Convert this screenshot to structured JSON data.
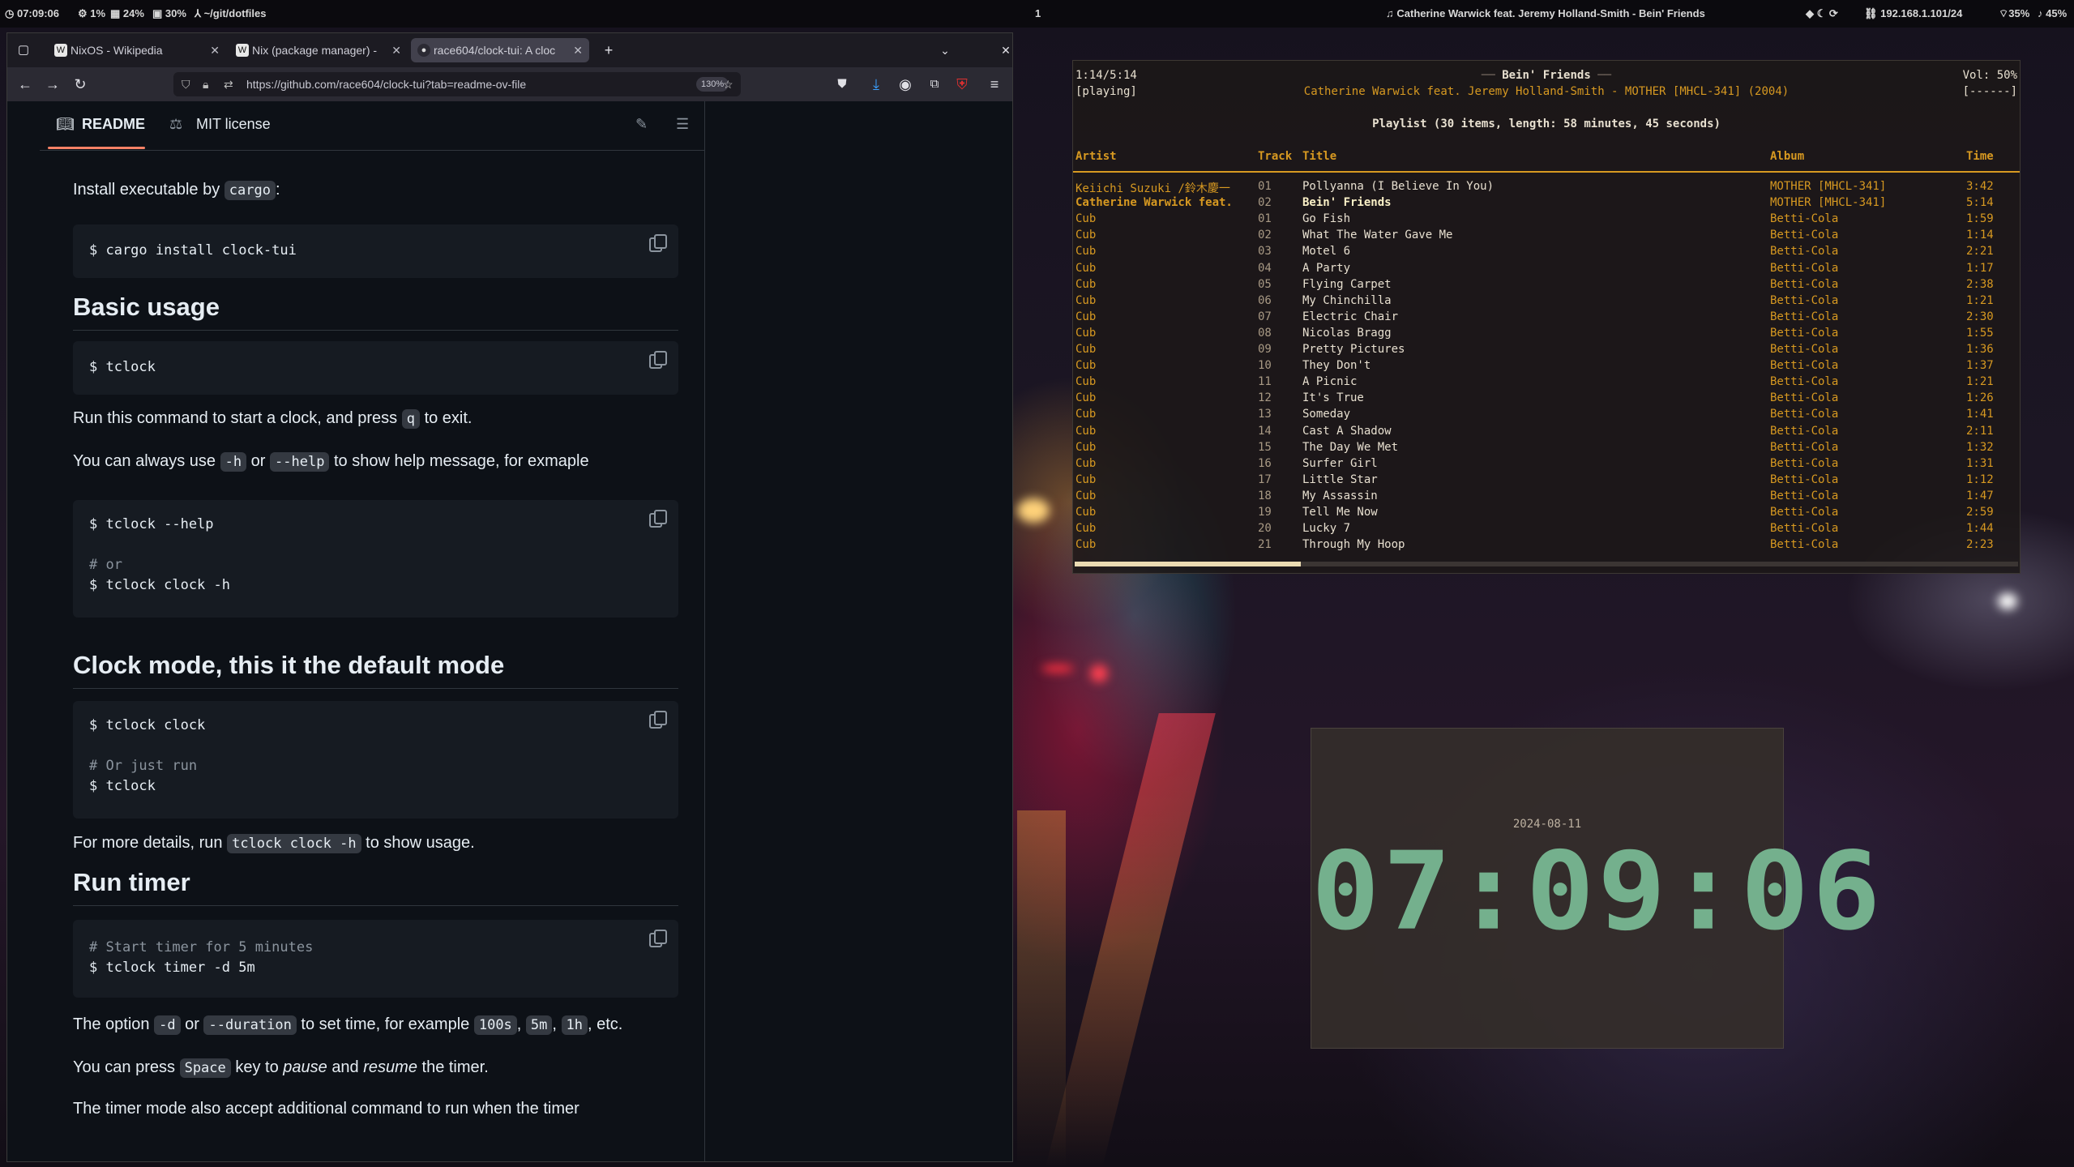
{
  "topbar": {
    "time": "07:09:06",
    "cpu": "1%",
    "mem": "24%",
    "disk": "30%",
    "cwd": "~/git/dotfiles",
    "workspace": "1",
    "now_playing": "Catherine Warwick feat. Jeremy Holland-Smith - Bein' Friends",
    "ip": "192.168.1.101/24",
    "wifi": "35%",
    "volume": "45%"
  },
  "browser": {
    "tabs": [
      {
        "label": "NixOS - Wikipedia",
        "icon": "W"
      },
      {
        "label": "Nix (package manager) -",
        "icon": "W"
      },
      {
        "label": "race604/clock-tui: A cloc",
        "icon": "github"
      }
    ],
    "url": "https://github.com/race604/clock-tui?tab=readme-ov-file",
    "zoom": "130%"
  },
  "readme": {
    "tab_readme": "README",
    "tab_license": "MIT license",
    "install_text": "Install executable by",
    "install_code": "cargo",
    "install_cmd": "$ cargo install clock-tui",
    "h_basic": "Basic usage",
    "basic_cmd": "$ tclock",
    "run_text_1": "Run this command to start a clock, and press",
    "run_key": "q",
    "run_text_2": "to exit.",
    "help_text_1": "You can always use",
    "help_opt1": "-h",
    "help_or": "or",
    "help_opt2": "--help",
    "help_text_2": "to show help message, for exmaple",
    "help_code_1": "$ tclock --help",
    "help_code_2": "# or",
    "help_code_3": "$ tclock clock -h",
    "h_clock": "Clock mode, this it the default mode",
    "clock_code_1": "$ tclock clock",
    "clock_code_2": "# Or just run",
    "clock_code_3": "$ tclock",
    "details_text_1": "For more details, run",
    "details_code": "tclock clock -h",
    "details_text_2": "to show usage.",
    "h_timer": "Run timer",
    "timer_code_1": "# Start timer for 5 minutes",
    "timer_code_2": "$ tclock timer -d 5m",
    "opt_text_1": "The option",
    "opt_d": "-d",
    "opt_or": "or",
    "opt_duration": "--duration",
    "opt_text_2": "to set time, for example",
    "opt_ex1": "100s",
    "opt_ex2": "5m",
    "opt_ex3": "1h",
    "opt_text_3": ", etc.",
    "space_text_1": "You can press",
    "space_key": "Space",
    "space_text_2": "key to",
    "space_pause": "pause",
    "space_and": "and",
    "space_resume": "resume",
    "space_text_3": "the timer.",
    "last_line": "The timer mode also accept additional command to run when the timer"
  },
  "player": {
    "position": "1:14/5:14",
    "state": "[playing]",
    "song_title": "Bein' Friends",
    "song_line": "Catherine Warwick feat. Jeremy Holland-Smith - MOTHER [MHCL-341] (2004)",
    "volume": "Vol: 50%",
    "flags": "[------]",
    "playlist_info": "Playlist (30 items, length: 58 minutes, 45 seconds)",
    "progress": 0.24,
    "columns": [
      "Artist",
      "Track",
      "Title",
      "Album",
      "Time"
    ],
    "rows": [
      {
        "artist": "Keiichi Suzuki /鈴木慶一",
        "track": "01",
        "title": "Pollyanna (I Believe In You)",
        "album": "MOTHER [MHCL-341]",
        "time": "3:42"
      },
      {
        "artist": "Catherine Warwick feat.",
        "track": "02",
        "title": "Bein' Friends",
        "album": "MOTHER [MHCL-341]",
        "time": "5:14"
      },
      {
        "artist": "Cub",
        "track": "01",
        "title": "Go Fish",
        "album": "Betti-Cola",
        "time": "1:59"
      },
      {
        "artist": "Cub",
        "track": "02",
        "title": "What The Water Gave Me",
        "album": "Betti-Cola",
        "time": "1:14"
      },
      {
        "artist": "Cub",
        "track": "03",
        "title": "Motel 6",
        "album": "Betti-Cola",
        "time": "2:21"
      },
      {
        "artist": "Cub",
        "track": "04",
        "title": "A Party",
        "album": "Betti-Cola",
        "time": "1:17"
      },
      {
        "artist": "Cub",
        "track": "05",
        "title": "Flying Carpet",
        "album": "Betti-Cola",
        "time": "2:38"
      },
      {
        "artist": "Cub",
        "track": "06",
        "title": "My Chinchilla",
        "album": "Betti-Cola",
        "time": "1:21"
      },
      {
        "artist": "Cub",
        "track": "07",
        "title": "Electric Chair",
        "album": "Betti-Cola",
        "time": "2:30"
      },
      {
        "artist": "Cub",
        "track": "08",
        "title": "Nicolas Bragg",
        "album": "Betti-Cola",
        "time": "1:55"
      },
      {
        "artist": "Cub",
        "track": "09",
        "title": "Pretty Pictures",
        "album": "Betti-Cola",
        "time": "1:36"
      },
      {
        "artist": "Cub",
        "track": "10",
        "title": "They Don't",
        "album": "Betti-Cola",
        "time": "1:37"
      },
      {
        "artist": "Cub",
        "track": "11",
        "title": "A Picnic",
        "album": "Betti-Cola",
        "time": "1:21"
      },
      {
        "artist": "Cub",
        "track": "12",
        "title": "It's True",
        "album": "Betti-Cola",
        "time": "1:26"
      },
      {
        "artist": "Cub",
        "track": "13",
        "title": "Someday",
        "album": "Betti-Cola",
        "time": "1:41"
      },
      {
        "artist": "Cub",
        "track": "14",
        "title": "Cast A Shadow",
        "album": "Betti-Cola",
        "time": "2:11"
      },
      {
        "artist": "Cub",
        "track": "15",
        "title": "The Day We Met",
        "album": "Betti-Cola",
        "time": "1:32"
      },
      {
        "artist": "Cub",
        "track": "16",
        "title": "Surfer Girl",
        "album": "Betti-Cola",
        "time": "1:31"
      },
      {
        "artist": "Cub",
        "track": "17",
        "title": "Little Star",
        "album": "Betti-Cola",
        "time": "1:12"
      },
      {
        "artist": "Cub",
        "track": "18",
        "title": "My Assassin",
        "album": "Betti-Cola",
        "time": "1:47"
      },
      {
        "artist": "Cub",
        "track": "19",
        "title": "Tell Me Now",
        "album": "Betti-Cola",
        "time": "2:59"
      },
      {
        "artist": "Cub",
        "track": "20",
        "title": "Lucky 7",
        "album": "Betti-Cola",
        "time": "1:44"
      },
      {
        "artist": "Cub",
        "track": "21",
        "title": "Through My Hoop",
        "album": "Betti-Cola",
        "time": "2:23"
      }
    ],
    "current_index": 1
  },
  "clock": {
    "date": "2024-08-11",
    "time": "07:09:06"
  },
  "colors": {
    "accent": "#d79921",
    "clock_digits": "#74b08d",
    "github_bg": "#0d1117"
  }
}
